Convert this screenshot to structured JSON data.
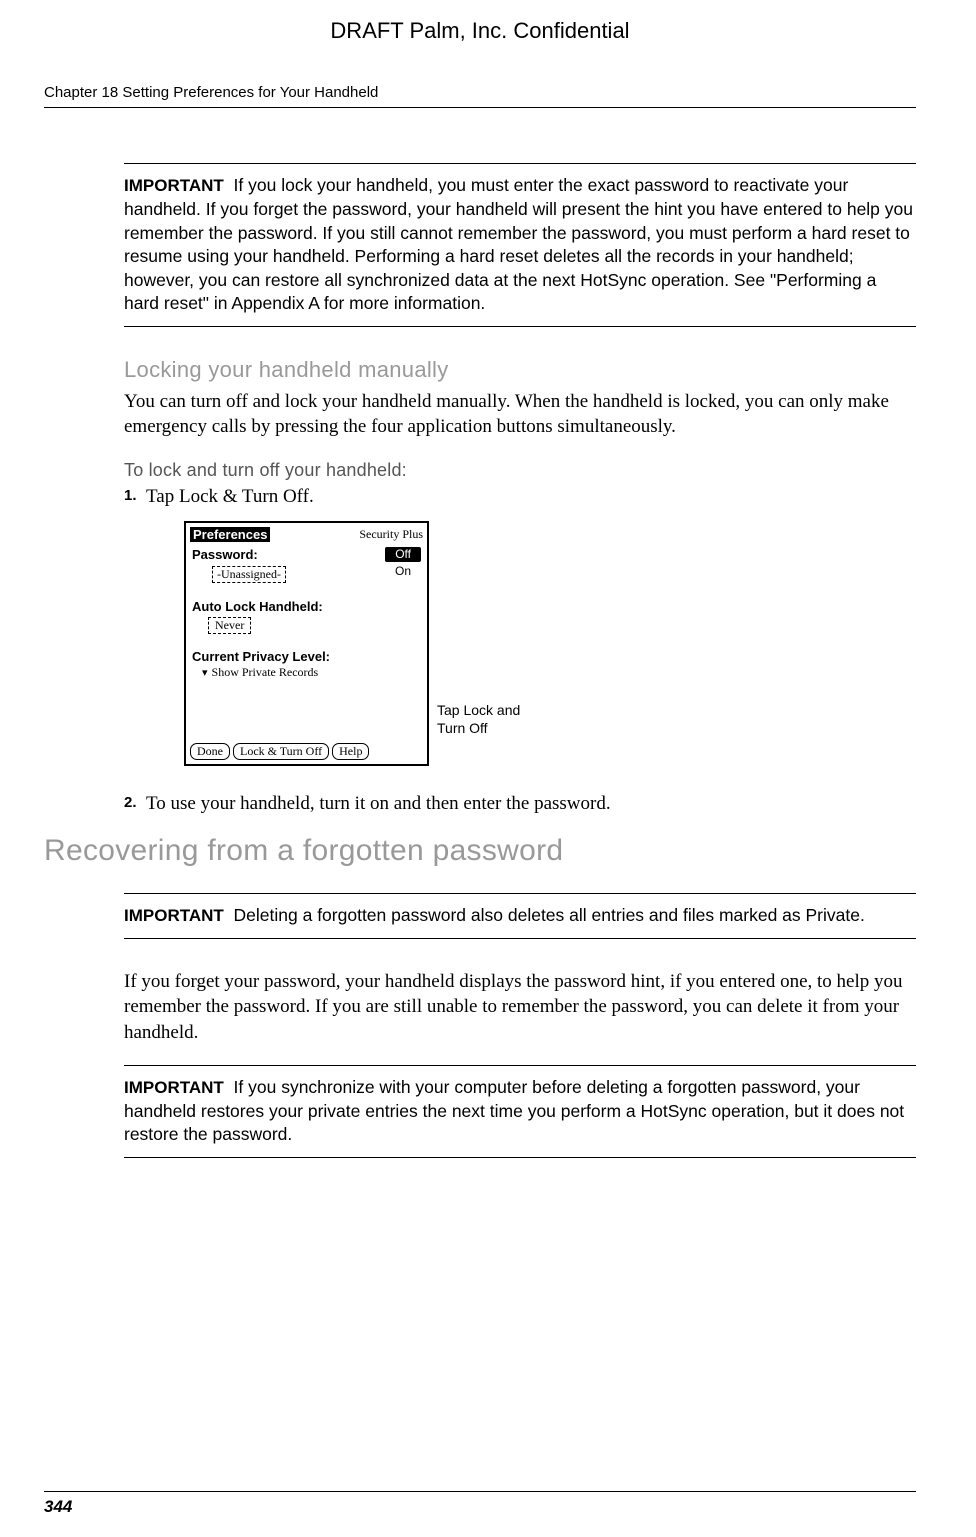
{
  "draft_header": "DRAFT   Palm, Inc. Confidential",
  "chapter_line": "Chapter 18   Setting Preferences for Your Handheld",
  "important1": {
    "label": "IMPORTANT",
    "text_pre": "If you lock your handheld, you must enter the exact password to reactivate your handheld. If you forget the password, your handheld will present the hint you have entered to help you remember the password. If you still cannot remember the password, you must perform a hard reset to resume using your handheld. Performing a hard reset deletes all the records in your handheld; however, you can restore all synchronized data at the next HotSync operation. See ",
    "xref1": "\"Performing a hard reset\"",
    "text_mid": " in ",
    "xref2": "Appendix A",
    "text_post": " for more information."
  },
  "section_lock": {
    "heading": "Locking your handheld manually",
    "body": "You can turn off and lock your handheld manually. When the handheld is locked, you can only make emergency calls by pressing the four application buttons simultaneously.",
    "subhead": "To lock and turn off your handheld:",
    "step1_num": "1.",
    "step1_text": "Tap Lock & Turn Off.",
    "step2_num": "2.",
    "step2_text": "To use your handheld, turn it on and then enter the password."
  },
  "palm_screen": {
    "title": "Preferences",
    "title_right": "Security Plus",
    "password_label": "Password:",
    "off": "Off",
    "on": "On",
    "unassigned": "-Unassigned-",
    "autolock_label": "Auto Lock Handheld:",
    "never": "Never",
    "privacy_label": "Current Privacy Level:",
    "show_private": "Show Private Records",
    "done": "Done",
    "lock_turn_off": "Lock & Turn Off",
    "help": "Help"
  },
  "callout": "Tap Lock and Turn Off",
  "h2_recovering": "Recovering from a forgotten password",
  "important2": {
    "label": "IMPORTANT",
    "text": "Deleting a forgotten password also deletes all entries and files marked as Private."
  },
  "body_forget": "If you forget your password, your handheld displays the password hint, if you entered one, to help you remember the password. If you are still unable to remember the password, you can delete it from your handheld.",
  "important3": {
    "label": "IMPORTANT",
    "text": "If you synchronize with your computer before deleting a forgotten password, your handheld restores your private entries the next time you perform a HotSync operation, but it does not restore the password."
  },
  "page_num": "344"
}
